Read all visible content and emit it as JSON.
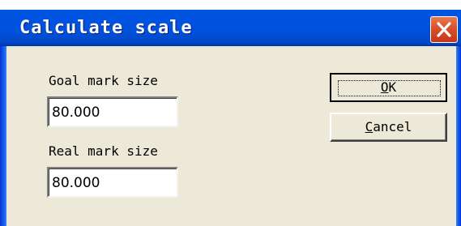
{
  "dialog": {
    "title": "Calculate scale",
    "goal_label": "Goal mark size",
    "goal_value": "80.000",
    "real_label": "Real mark size",
    "real_value": "80.000",
    "ok_label": {
      "mnemonic": "O",
      "rest": "K"
    },
    "cancel_label": {
      "mnemonic": "C",
      "rest": "ancel"
    }
  },
  "colors": {
    "title_bar": "#0054e3",
    "close_button": "#d8502a",
    "dialog_background": "#ece9d8"
  },
  "icons": {
    "close": "close-x-icon"
  }
}
